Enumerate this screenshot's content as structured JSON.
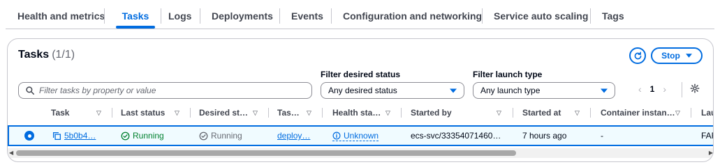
{
  "tabs": [
    {
      "label": "Health and metrics"
    },
    {
      "label": "Tasks"
    },
    {
      "label": "Logs"
    },
    {
      "label": "Deployments"
    },
    {
      "label": "Events"
    },
    {
      "label": "Configuration and networking"
    },
    {
      "label": "Service auto scaling"
    },
    {
      "label": "Tags"
    }
  ],
  "active_tab": "Tasks",
  "panel": {
    "title": "Tasks",
    "count": "(1/1)",
    "stop_label": "Stop"
  },
  "filters": {
    "search_placeholder": "Filter tasks by property or value",
    "desired_status_label": "Filter desired status",
    "desired_status_value": "Any desired status",
    "launch_type_label": "Filter launch type",
    "launch_type_value": "Any launch type"
  },
  "pagination": {
    "current_page": "1"
  },
  "columns": [
    "Task",
    "Last status",
    "Desired st…",
    "Tas…",
    "Health sta…",
    "Started by",
    "Started at",
    "Container instan…",
    "Lau"
  ],
  "rows": [
    {
      "task": "5b0b4…",
      "last_status": "Running",
      "desired_status": "Running",
      "task_definition": "deploy…",
      "health_status": "Unknown",
      "started_by": "ecs-svc/33354071460…",
      "started_at": "7 hours ago",
      "container_instance": "-",
      "launch_type": "FAR"
    }
  ],
  "colors": {
    "accent": "#006ce0",
    "success": "#00802f",
    "selected_row_bg": "#f0fbff"
  },
  "icons": {
    "refresh": "refresh-icon",
    "stop_caret": "caret-down-icon",
    "search": "search-icon",
    "settings": "gear-icon",
    "copy": "copy-icon",
    "running": "check-circle-icon",
    "desired_running": "check-circle-outline-icon",
    "health": "info-icon"
  }
}
